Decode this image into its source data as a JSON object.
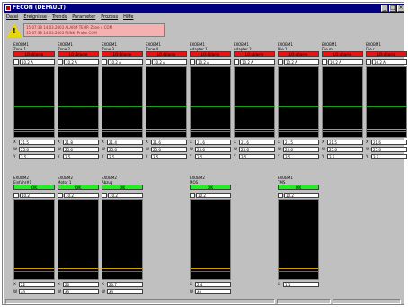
{
  "window": {
    "title": "FECON (DEFAULT)"
  },
  "menu": [
    "Datei",
    "Ereignisse",
    "Trends",
    "Parameter",
    "Prozess",
    "Hilfe"
  ],
  "alarms": [
    "15:07:38 14.03.2003 ALARM TEMP. Zone 4 COM",
    "15:07:38 14.03.2003 FUNK. Probe COM"
  ],
  "panels_top": [
    {
      "device": "EXOBM1",
      "name": "Zone 1",
      "status": "LO-Alarm",
      "setpoint": "10.2 A",
      "readouts": [
        "21.5",
        "25.6",
        "3.5"
      ]
    },
    {
      "device": "EXOBM1",
      "name": "Zone 2",
      "status": "LO-Alarm",
      "setpoint": "10.2 A",
      "readouts": [
        "21.8",
        "25.6",
        "3.5"
      ]
    },
    {
      "device": "EXOBM1",
      "name": "Zone 3",
      "status": "LO-Alarm",
      "setpoint": "10.2 A",
      "readouts": [
        "21.4",
        "25.6",
        "3.5"
      ]
    },
    {
      "device": "EXOBM1",
      "name": "Zone 4",
      "status": "LO-Alarm",
      "setpoint": "10.2 A",
      "readouts": [
        "21.6",
        "25.6",
        "3.5"
      ]
    },
    {
      "device": "EXOBM1",
      "name": "Adapter 1",
      "status": "LO-Alarm",
      "setpoint": "10.2 A",
      "readouts": [
        "21.6",
        "25.6",
        "3.5"
      ]
    },
    {
      "device": "EXOBM1",
      "name": "Adapter 2",
      "status": "LO-Alarm",
      "setpoint": "10.2 A",
      "readouts": [
        "21.6",
        "25.6",
        "3.5"
      ]
    },
    {
      "device": "EXOBM1",
      "name": "Die 1",
      "status": "LO-Alarm",
      "setpoint": "10.2 A",
      "readouts": [
        "21.5",
        "25.6",
        "3.5"
      ]
    },
    {
      "device": "EXOBM1",
      "name": "Die m",
      "status": "LO-Alarm",
      "setpoint": "10.2 A",
      "readouts": [
        "21.5",
        "25.6",
        "3.5"
      ]
    },
    {
      "device": "EXOBM1",
      "name": "Die r",
      "status": "LO-Alarm",
      "setpoint": "10.2 A",
      "readouts": [
        "21.6",
        "25.6",
        "3.5"
      ]
    }
  ],
  "panels_bottom": [
    {
      "device": "EXOBM2",
      "name": "Einfuhr#1",
      "status": "OK",
      "setpoint": "10.2",
      "readouts": [
        "22",
        "40"
      ]
    },
    {
      "device": "EXOBM2",
      "name": "Motor 1",
      "status": "OK",
      "setpoint": "10.2",
      "readouts": [
        "20",
        "40"
      ]
    },
    {
      "device": "EXOBM2",
      "name": "Abzug",
      "status": "OK",
      "setpoint": "10.2",
      "readouts": [
        "20.7",
        "40"
      ]
    },
    {
      "device": "EXOBM2",
      "name": "MOS",
      "status": "OK",
      "setpoint": "10.2",
      "readouts": [
        "2.4",
        "40"
      ]
    },
    {
      "device": "EXOBM1",
      "name": "TMS",
      "status": "OK",
      "setpoint": "10.2",
      "readouts": [
        "1.1"
      ]
    }
  ],
  "readout_labels_top": [
    "X",
    "W",
    "Y"
  ],
  "readout_labels_bottom": [
    "X",
    "W"
  ],
  "colors": {
    "alarm": "#ee1111",
    "ok": "#22ee22",
    "titlebar": "#000080",
    "plot_bg": "#000000"
  }
}
